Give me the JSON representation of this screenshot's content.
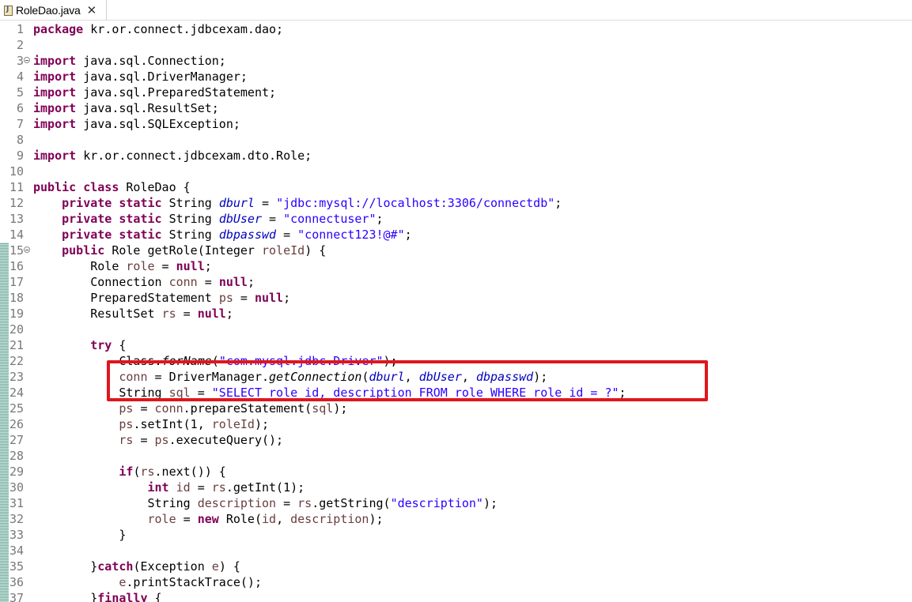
{
  "tab": {
    "label": "RoleDao.java",
    "close": "✕"
  },
  "lines": [
    {
      "n": "1",
      "fold": false,
      "mark": false,
      "tokens": [
        {
          "t": "package",
          "c": "kw"
        },
        {
          "t": " kr.or.connect.jdbcexam.dao;",
          "c": ""
        }
      ]
    },
    {
      "n": "2",
      "fold": false,
      "mark": false,
      "tokens": []
    },
    {
      "n": "3",
      "fold": true,
      "mark": false,
      "tokens": [
        {
          "t": "import",
          "c": "kw"
        },
        {
          "t": " java.sql.Connection;",
          "c": ""
        }
      ]
    },
    {
      "n": "4",
      "fold": false,
      "mark": false,
      "tokens": [
        {
          "t": "import",
          "c": "kw"
        },
        {
          "t": " java.sql.DriverManager;",
          "c": ""
        }
      ]
    },
    {
      "n": "5",
      "fold": false,
      "mark": false,
      "tokens": [
        {
          "t": "import",
          "c": "kw"
        },
        {
          "t": " java.sql.PreparedStatement;",
          "c": ""
        }
      ]
    },
    {
      "n": "6",
      "fold": false,
      "mark": false,
      "tokens": [
        {
          "t": "import",
          "c": "kw"
        },
        {
          "t": " java.sql.ResultSet;",
          "c": ""
        }
      ]
    },
    {
      "n": "7",
      "fold": false,
      "mark": false,
      "tokens": [
        {
          "t": "import",
          "c": "kw"
        },
        {
          "t": " java.sql.SQLException;",
          "c": ""
        }
      ]
    },
    {
      "n": "8",
      "fold": false,
      "mark": false,
      "tokens": []
    },
    {
      "n": "9",
      "fold": false,
      "mark": false,
      "tokens": [
        {
          "t": "import",
          "c": "kw"
        },
        {
          "t": " kr.or.connect.jdbcexam.dto.Role;",
          "c": ""
        }
      ]
    },
    {
      "n": "10",
      "fold": false,
      "mark": false,
      "tokens": []
    },
    {
      "n": "11",
      "fold": false,
      "mark": false,
      "tokens": [
        {
          "t": "public",
          "c": "kw"
        },
        {
          "t": " ",
          "c": ""
        },
        {
          "t": "class",
          "c": "kw"
        },
        {
          "t": " RoleDao {",
          "c": ""
        }
      ]
    },
    {
      "n": "12",
      "fold": false,
      "mark": false,
      "tokens": [
        {
          "t": "    ",
          "c": ""
        },
        {
          "t": "private",
          "c": "kw"
        },
        {
          "t": " ",
          "c": ""
        },
        {
          "t": "static",
          "c": "kw"
        },
        {
          "t": " String ",
          "c": ""
        },
        {
          "t": "dburl",
          "c": "fld"
        },
        {
          "t": " = ",
          "c": ""
        },
        {
          "t": "\"jdbc:mysql://localhost:3306/connectdb\"",
          "c": "str"
        },
        {
          "t": ";",
          "c": ""
        }
      ]
    },
    {
      "n": "13",
      "fold": false,
      "mark": false,
      "tokens": [
        {
          "t": "    ",
          "c": ""
        },
        {
          "t": "private",
          "c": "kw"
        },
        {
          "t": " ",
          "c": ""
        },
        {
          "t": "static",
          "c": "kw"
        },
        {
          "t": " String ",
          "c": ""
        },
        {
          "t": "dbUser",
          "c": "fld"
        },
        {
          "t": " = ",
          "c": ""
        },
        {
          "t": "\"connectuser\"",
          "c": "str"
        },
        {
          "t": ";",
          "c": ""
        }
      ]
    },
    {
      "n": "14",
      "fold": false,
      "mark": false,
      "tokens": [
        {
          "t": "    ",
          "c": ""
        },
        {
          "t": "private",
          "c": "kw"
        },
        {
          "t": " ",
          "c": ""
        },
        {
          "t": "static",
          "c": "kw"
        },
        {
          "t": " String ",
          "c": ""
        },
        {
          "t": "dbpasswd",
          "c": "fld"
        },
        {
          "t": " = ",
          "c": ""
        },
        {
          "t": "\"connect123!@#\"",
          "c": "str"
        },
        {
          "t": ";",
          "c": ""
        }
      ]
    },
    {
      "n": "15",
      "fold": true,
      "mark": true,
      "tokens": [
        {
          "t": "    ",
          "c": ""
        },
        {
          "t": "public",
          "c": "kw"
        },
        {
          "t": " Role getRole(Integer ",
          "c": ""
        },
        {
          "t": "roleId",
          "c": "var"
        },
        {
          "t": ") {",
          "c": ""
        }
      ]
    },
    {
      "n": "16",
      "fold": false,
      "mark": true,
      "tokens": [
        {
          "t": "        Role ",
          "c": ""
        },
        {
          "t": "role",
          "c": "var"
        },
        {
          "t": " = ",
          "c": ""
        },
        {
          "t": "null",
          "c": "kw"
        },
        {
          "t": ";",
          "c": ""
        }
      ]
    },
    {
      "n": "17",
      "fold": false,
      "mark": true,
      "tokens": [
        {
          "t": "        Connection ",
          "c": ""
        },
        {
          "t": "conn",
          "c": "var"
        },
        {
          "t": " = ",
          "c": ""
        },
        {
          "t": "null",
          "c": "kw"
        },
        {
          "t": ";",
          "c": ""
        }
      ]
    },
    {
      "n": "18",
      "fold": false,
      "mark": true,
      "tokens": [
        {
          "t": "        PreparedStatement ",
          "c": ""
        },
        {
          "t": "ps",
          "c": "var"
        },
        {
          "t": " = ",
          "c": ""
        },
        {
          "t": "null",
          "c": "kw"
        },
        {
          "t": ";",
          "c": ""
        }
      ]
    },
    {
      "n": "19",
      "fold": false,
      "mark": true,
      "tokens": [
        {
          "t": "        ResultSet ",
          "c": ""
        },
        {
          "t": "rs",
          "c": "var"
        },
        {
          "t": " = ",
          "c": ""
        },
        {
          "t": "null",
          "c": "kw"
        },
        {
          "t": ";",
          "c": ""
        }
      ]
    },
    {
      "n": "20",
      "fold": false,
      "mark": true,
      "tokens": []
    },
    {
      "n": "21",
      "fold": false,
      "mark": true,
      "tokens": [
        {
          "t": "        ",
          "c": ""
        },
        {
          "t": "try",
          "c": "kw"
        },
        {
          "t": " {",
          "c": ""
        }
      ]
    },
    {
      "n": "22",
      "fold": false,
      "mark": true,
      "tokens": [
        {
          "t": "            Class.",
          "c": ""
        },
        {
          "t": "forName",
          "c": "mtd"
        },
        {
          "t": "(",
          "c": ""
        },
        {
          "t": "\"com.mysql.jdbc.Driver\"",
          "c": "str"
        },
        {
          "t": ");",
          "c": ""
        }
      ]
    },
    {
      "n": "23",
      "fold": false,
      "mark": true,
      "tokens": [
        {
          "t": "            ",
          "c": ""
        },
        {
          "t": "conn",
          "c": "var"
        },
        {
          "t": " = DriverManager.",
          "c": ""
        },
        {
          "t": "getConnection",
          "c": "mtd"
        },
        {
          "t": "(",
          "c": ""
        },
        {
          "t": "dburl",
          "c": "fld"
        },
        {
          "t": ", ",
          "c": ""
        },
        {
          "t": "dbUser",
          "c": "fld"
        },
        {
          "t": ", ",
          "c": ""
        },
        {
          "t": "dbpasswd",
          "c": "fld"
        },
        {
          "t": ");",
          "c": ""
        }
      ]
    },
    {
      "n": "24",
      "fold": false,
      "mark": true,
      "tokens": [
        {
          "t": "            String ",
          "c": ""
        },
        {
          "t": "sql",
          "c": "var"
        },
        {
          "t": " = ",
          "c": ""
        },
        {
          "t": "\"SELECT role_id, description FROM role WHERE role_id = ?\"",
          "c": "str"
        },
        {
          "t": ";",
          "c": ""
        }
      ]
    },
    {
      "n": "25",
      "fold": false,
      "mark": true,
      "tokens": [
        {
          "t": "            ",
          "c": ""
        },
        {
          "t": "ps",
          "c": "var"
        },
        {
          "t": " = ",
          "c": ""
        },
        {
          "t": "conn",
          "c": "var"
        },
        {
          "t": ".prepareStatement(",
          "c": ""
        },
        {
          "t": "sql",
          "c": "var"
        },
        {
          "t": ");",
          "c": ""
        }
      ]
    },
    {
      "n": "26",
      "fold": false,
      "mark": true,
      "tokens": [
        {
          "t": "            ",
          "c": ""
        },
        {
          "t": "ps",
          "c": "var"
        },
        {
          "t": ".setInt(1, ",
          "c": ""
        },
        {
          "t": "roleId",
          "c": "var"
        },
        {
          "t": ");",
          "c": ""
        }
      ]
    },
    {
      "n": "27",
      "fold": false,
      "mark": true,
      "tokens": [
        {
          "t": "            ",
          "c": ""
        },
        {
          "t": "rs",
          "c": "var"
        },
        {
          "t": " = ",
          "c": ""
        },
        {
          "t": "ps",
          "c": "var"
        },
        {
          "t": ".executeQuery();",
          "c": ""
        }
      ]
    },
    {
      "n": "28",
      "fold": false,
      "mark": true,
      "tokens": []
    },
    {
      "n": "29",
      "fold": false,
      "mark": true,
      "tokens": [
        {
          "t": "            ",
          "c": ""
        },
        {
          "t": "if",
          "c": "kw"
        },
        {
          "t": "(",
          "c": ""
        },
        {
          "t": "rs",
          "c": "var"
        },
        {
          "t": ".next()) {",
          "c": ""
        }
      ]
    },
    {
      "n": "30",
      "fold": false,
      "mark": true,
      "tokens": [
        {
          "t": "                ",
          "c": ""
        },
        {
          "t": "int",
          "c": "kw"
        },
        {
          "t": " ",
          "c": ""
        },
        {
          "t": "id",
          "c": "var"
        },
        {
          "t": " = ",
          "c": ""
        },
        {
          "t": "rs",
          "c": "var"
        },
        {
          "t": ".getInt(1);",
          "c": ""
        }
      ]
    },
    {
      "n": "31",
      "fold": false,
      "mark": true,
      "tokens": [
        {
          "t": "                String ",
          "c": ""
        },
        {
          "t": "description",
          "c": "var"
        },
        {
          "t": " = ",
          "c": ""
        },
        {
          "t": "rs",
          "c": "var"
        },
        {
          "t": ".getString(",
          "c": ""
        },
        {
          "t": "\"description\"",
          "c": "str"
        },
        {
          "t": ");",
          "c": ""
        }
      ]
    },
    {
      "n": "32",
      "fold": false,
      "mark": true,
      "tokens": [
        {
          "t": "                ",
          "c": ""
        },
        {
          "t": "role",
          "c": "var"
        },
        {
          "t": " = ",
          "c": ""
        },
        {
          "t": "new",
          "c": "kw"
        },
        {
          "t": " Role(",
          "c": ""
        },
        {
          "t": "id",
          "c": "var"
        },
        {
          "t": ", ",
          "c": ""
        },
        {
          "t": "description",
          "c": "var"
        },
        {
          "t": ");",
          "c": ""
        }
      ]
    },
    {
      "n": "33",
      "fold": false,
      "mark": true,
      "tokens": [
        {
          "t": "            }",
          "c": ""
        }
      ]
    },
    {
      "n": "34",
      "fold": false,
      "mark": true,
      "tokens": []
    },
    {
      "n": "35",
      "fold": false,
      "mark": true,
      "tokens": [
        {
          "t": "        }",
          "c": ""
        },
        {
          "t": "catch",
          "c": "kw"
        },
        {
          "t": "(Exception ",
          "c": ""
        },
        {
          "t": "e",
          "c": "var"
        },
        {
          "t": ") {",
          "c": ""
        }
      ]
    },
    {
      "n": "36",
      "fold": false,
      "mark": true,
      "tokens": [
        {
          "t": "            ",
          "c": ""
        },
        {
          "t": "e",
          "c": "var"
        },
        {
          "t": ".printStackTrace();",
          "c": ""
        }
      ]
    },
    {
      "n": "37",
      "fold": false,
      "mark": true,
      "tokens": [
        {
          "t": "        }",
          "c": ""
        },
        {
          "t": "finally",
          "c": "kw"
        },
        {
          "t": " {",
          "c": ""
        }
      ]
    }
  ]
}
